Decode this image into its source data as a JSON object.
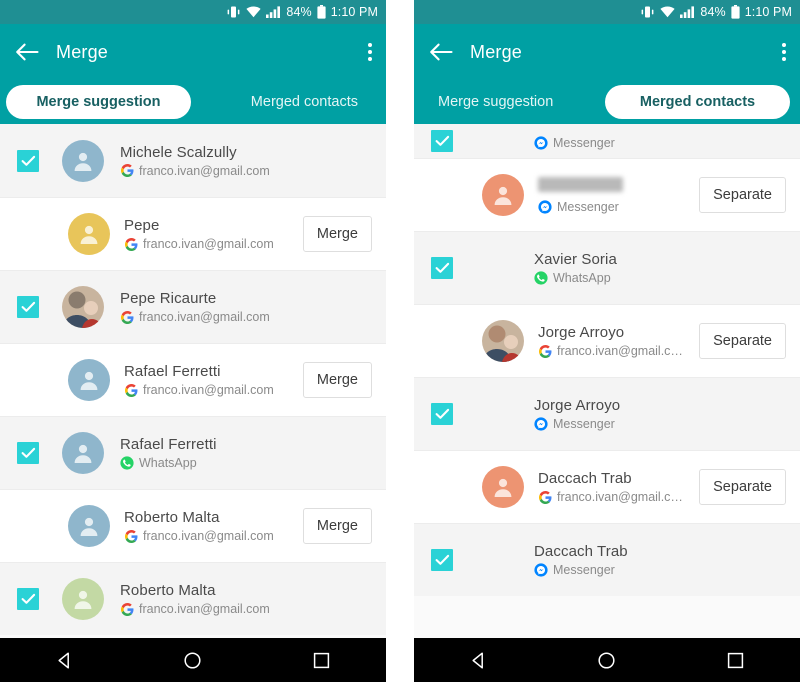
{
  "status_bar": {
    "battery_percent": "84%",
    "time": "1:10 PM",
    "icons": [
      "vibrate-icon",
      "wifi-icon",
      "signal-icon",
      "battery-icon"
    ]
  },
  "colors": {
    "status_bar_bg": "#1f8f93",
    "app_bar_bg": "#00a0a3",
    "checkbox": "#2ad2d6",
    "avatar_blue": "#8fb6cc",
    "avatar_yellow": "#e8c55a",
    "avatar_orange": "#ed9472",
    "avatar_green": "#c3d9a4",
    "whatsapp_green": "#25d366",
    "messenger_blue": "#0084ff",
    "row_parent_bg": "#ffffff",
    "row_child_bg": "#f4f4f4"
  },
  "left_phone": {
    "app_bar": {
      "title": "Merge",
      "back_icon": "back-arrow-icon",
      "overflow_icon": "overflow-menu-icon"
    },
    "tabs": [
      {
        "label": "Merge suggestion",
        "active": true
      },
      {
        "label": "Merged contacts",
        "active": false
      }
    ],
    "rows": [
      {
        "type": "child",
        "checked": true,
        "avatar": "person-placeholder",
        "avatar_color": "#8fb6cc",
        "name": "Michele Scalzully",
        "redacted": false,
        "source": "google",
        "source_text": "franco.ivan@gmail.com",
        "action": null
      },
      {
        "type": "parent",
        "checked": false,
        "avatar": "person-placeholder",
        "avatar_color": "#e8c55a",
        "name": "Pepe",
        "redacted": false,
        "source": "google",
        "source_text": "franco.ivan@gmail.com",
        "action": "Merge"
      },
      {
        "type": "child",
        "checked": true,
        "avatar": "photo",
        "avatar_color": "#8a7c6e",
        "name": "Pepe Ricaurte",
        "redacted": false,
        "source": "google",
        "source_text": "franco.ivan@gmail.com",
        "action": null
      },
      {
        "type": "parent",
        "checked": false,
        "avatar": "person-placeholder",
        "avatar_color": "#8fb6cc",
        "name": "Rafael Ferretti",
        "redacted": false,
        "source": "google",
        "source_text": "franco.ivan@gmail.com",
        "action": "Merge"
      },
      {
        "type": "child",
        "checked": true,
        "avatar": "person-placeholder",
        "avatar_color": "#8fb6cc",
        "name": "Rafael Ferretti",
        "redacted": false,
        "source": "whatsapp",
        "source_text": "WhatsApp",
        "action": null
      },
      {
        "type": "parent",
        "checked": false,
        "avatar": "person-placeholder",
        "avatar_color": "#8fb6cc",
        "name": "Roberto Malta",
        "redacted": false,
        "source": "google",
        "source_text": "franco.ivan@gmail.com",
        "action": "Merge"
      },
      {
        "type": "child",
        "checked": true,
        "avatar": "person-placeholder",
        "avatar_color": "#c3d9a4",
        "name": "Roberto Malta",
        "redacted": false,
        "source": "google",
        "source_text": "franco.ivan@gmail.com",
        "action": null
      }
    ]
  },
  "right_phone": {
    "app_bar": {
      "title": "Merge",
      "back_icon": "back-arrow-icon",
      "overflow_icon": "overflow-menu-icon"
    },
    "tabs": [
      {
        "label": "Merge suggestion",
        "active": false
      },
      {
        "label": "Merged contacts",
        "active": true
      }
    ],
    "rows": [
      {
        "type": "child",
        "checked": true,
        "avatar": "none",
        "avatar_color": "",
        "name": "",
        "redacted": false,
        "source": "messenger",
        "source_text": "Messenger",
        "action": null,
        "partial_top": true
      },
      {
        "type": "parent",
        "checked": false,
        "avatar": "person-placeholder",
        "avatar_color": "#ed9472",
        "name": "Xavier Soria",
        "redacted": true,
        "source": "messenger",
        "source_text": "Messenger",
        "action": "Separate"
      },
      {
        "type": "child",
        "checked": true,
        "avatar": "none",
        "avatar_color": "",
        "name": "Xavier Soria",
        "redacted": false,
        "source": "whatsapp",
        "source_text": "WhatsApp",
        "action": null
      },
      {
        "type": "parent",
        "checked": false,
        "avatar": "photo",
        "avatar_color": "#b08b72",
        "name": "Jorge Arroyo",
        "redacted": false,
        "source": "google",
        "source_text": "franco.ivan@gmail.c…",
        "action": "Separate"
      },
      {
        "type": "child",
        "checked": true,
        "avatar": "none",
        "avatar_color": "",
        "name": "Jorge Arroyo",
        "redacted": false,
        "source": "messenger",
        "source_text": "Messenger",
        "action": null
      },
      {
        "type": "parent",
        "checked": false,
        "avatar": "person-placeholder",
        "avatar_color": "#ed9472",
        "name": "Daccach Trab",
        "redacted": false,
        "source": "google",
        "source_text": "franco.ivan@gmail.c…",
        "action": "Separate"
      },
      {
        "type": "child",
        "checked": true,
        "avatar": "none",
        "avatar_color": "",
        "name": "Daccach Trab",
        "redacted": false,
        "source": "messenger",
        "source_text": "Messenger",
        "action": null
      }
    ]
  },
  "nav_bar": {
    "buttons": [
      {
        "name": "back-nav-button",
        "icon": "triangle-back-icon"
      },
      {
        "name": "home-nav-button",
        "icon": "circle-home-icon"
      },
      {
        "name": "recents-nav-button",
        "icon": "square-recents-icon"
      }
    ]
  }
}
